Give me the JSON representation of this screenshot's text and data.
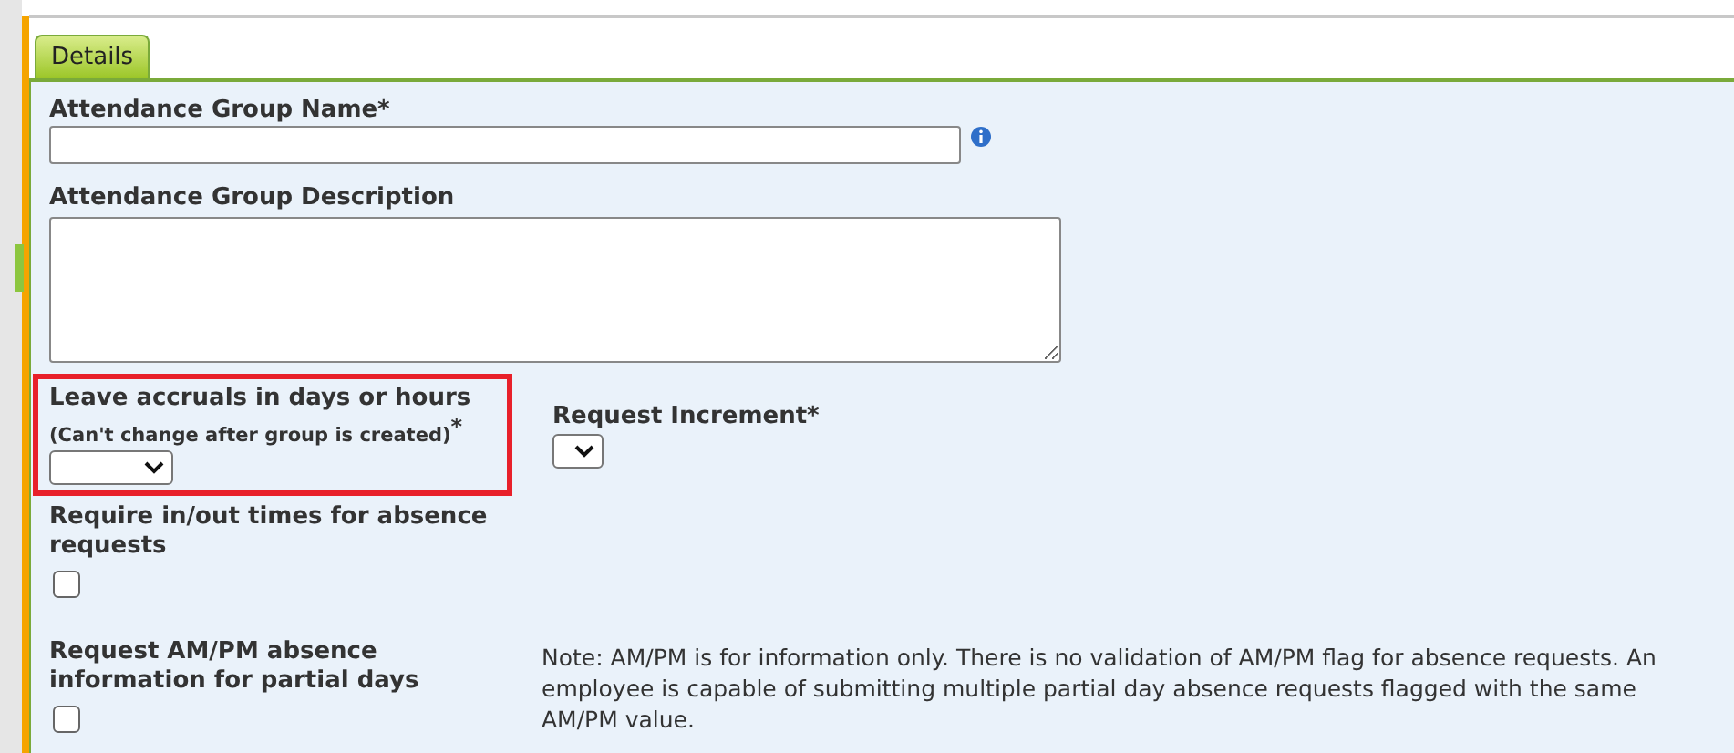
{
  "tabs": [
    {
      "label": "Details",
      "selected": true
    }
  ],
  "fields": {
    "name_label": "Attendance Group Name*",
    "description_label": "Attendance Group Description"
  },
  "accrual": {
    "label": "Leave accruals in days or hours",
    "hint": "(Can't change after group is created)",
    "required_mark": "*",
    "highlighted": true
  },
  "increment": {
    "label": "Request Increment*"
  },
  "checkboxes": [
    {
      "label_lines": [
        "Require in/out times for absence",
        "requests"
      ],
      "checked": false
    },
    {
      "label_lines": [
        "Request AM/PM absence",
        "information for partial days"
      ],
      "checked": false
    }
  ],
  "note_lines": [
    "Note: AM/PM is for information only. There is no validation of AM/PM flag for absence requests. An",
    "employee is capable of submitting multiple partial day absence requests flagged with the same",
    "AM/PM value."
  ]
}
